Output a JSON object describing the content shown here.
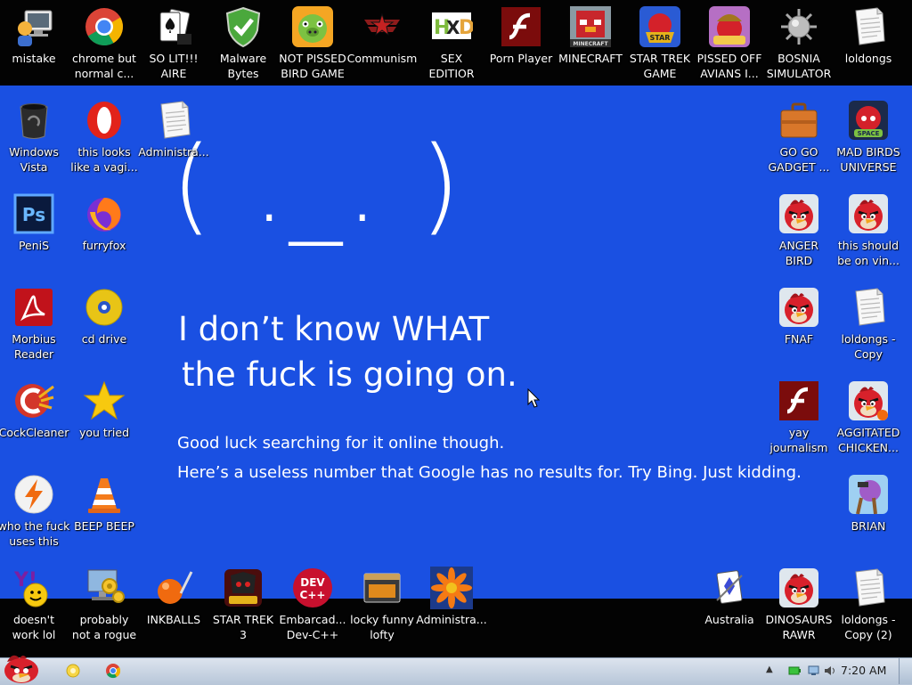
{
  "bsod": {
    "frown": "( ._. )",
    "headline_1": "I don’t know WHAT",
    "headline_2": "the fuck is going on.",
    "sub_1": "Good luck searching for it online though.",
    "sub_2": "Here’s a useless number that Google has no results for. Try Bing. Just kidding."
  },
  "icons": {
    "mistake": {
      "l1": "mistake",
      "l2": ""
    },
    "chrome": {
      "l1": "chrome but",
      "l2": "normal c..."
    },
    "solitaire": {
      "l1": "SO LIT!!!",
      "l2": "AIRE"
    },
    "malwarebytes": {
      "l1": "Malware",
      "l2": "Bytes"
    },
    "notpissed": {
      "l1": "NOT PISSED",
      "l2": "BIRD GAME"
    },
    "communism": {
      "l1": "Communism",
      "l2": ""
    },
    "sex": {
      "l1": "SEX",
      "l2": "EDITIOR"
    },
    "pornplayer": {
      "l1": "Porn Player",
      "l2": ""
    },
    "minecraft": {
      "l1": "MINECRAFT",
      "l2": ""
    },
    "startrek": {
      "l1": "STAR TREK",
      "l2": "GAME"
    },
    "pissedoff": {
      "l1": "PISSED OFF",
      "l2": "AVIANS I..."
    },
    "bosnia": {
      "l1": "BOSNIA",
      "l2": "SIMULATOR"
    },
    "loldongs": {
      "l1": "loldongs",
      "l2": ""
    },
    "vista": {
      "l1": "Windows",
      "l2": "Vista"
    },
    "opera": {
      "l1": "this looks",
      "l2": "like a vagi..."
    },
    "admin1": {
      "l1": "Administra...",
      "l2": ""
    },
    "gogo": {
      "l1": "GO GO",
      "l2": "GADGET ..."
    },
    "madbirds": {
      "l1": "MAD BIRDS",
      "l2": "UNIVERSE"
    },
    "penis": {
      "l1": "PeniS",
      "l2": ""
    },
    "furryfox": {
      "l1": "furryfox",
      "l2": ""
    },
    "angerbird": {
      "l1": "ANGER",
      "l2": "BIRD"
    },
    "thisshould": {
      "l1": "this should",
      "l2": "be on vin..."
    },
    "morbius": {
      "l1": "Morbius",
      "l2": "Reader"
    },
    "cddrive": {
      "l1": "cd drive",
      "l2": ""
    },
    "fnaf": {
      "l1": "FNAF",
      "l2": ""
    },
    "loldongscopy": {
      "l1": "loldongs -",
      "l2": "Copy"
    },
    "cockcleaner": {
      "l1": "CockCleaner",
      "l2": ""
    },
    "youtried": {
      "l1": "you tried",
      "l2": ""
    },
    "yay": {
      "l1": "yay",
      "l2": "journalism"
    },
    "agitated": {
      "l1": "AGGITATED",
      "l2": "CHICKEN..."
    },
    "whothe": {
      "l1": "who the fuck",
      "l2": "uses this"
    },
    "beepbeep": {
      "l1": "BEEP BEEP",
      "l2": ""
    },
    "brian": {
      "l1": "BRIAN",
      "l2": ""
    },
    "yahoo": {
      "l1": "doesn't",
      "l2": "work lol"
    },
    "rogue": {
      "l1": "probably",
      "l2": "not a rogue"
    },
    "inkballs": {
      "l1": "INKBALLS",
      "l2": ""
    },
    "startrek3": {
      "l1": "STAR TREK",
      "l2": "3"
    },
    "devcpp": {
      "l1": "Embarcad...",
      "l2": "Dev-C++"
    },
    "lofty": {
      "l1": "locky funny",
      "l2": "lofty"
    },
    "admin2": {
      "l1": "Administra...",
      "l2": ""
    },
    "australia": {
      "l1": "Australia",
      "l2": ""
    },
    "dinosaurs": {
      "l1": "DINOSAURS",
      "l2": "RAWR"
    },
    "loldongscopy2": {
      "l1": "loldongs -",
      "l2": "Copy (2)"
    }
  },
  "taskbar": {
    "clock": "7:20 AM",
    "tray_arrow": "▲"
  },
  "colors": {
    "bsod_blue": "#1a50e2",
    "band": "#030303",
    "taskbar": "#c9d5e4"
  }
}
